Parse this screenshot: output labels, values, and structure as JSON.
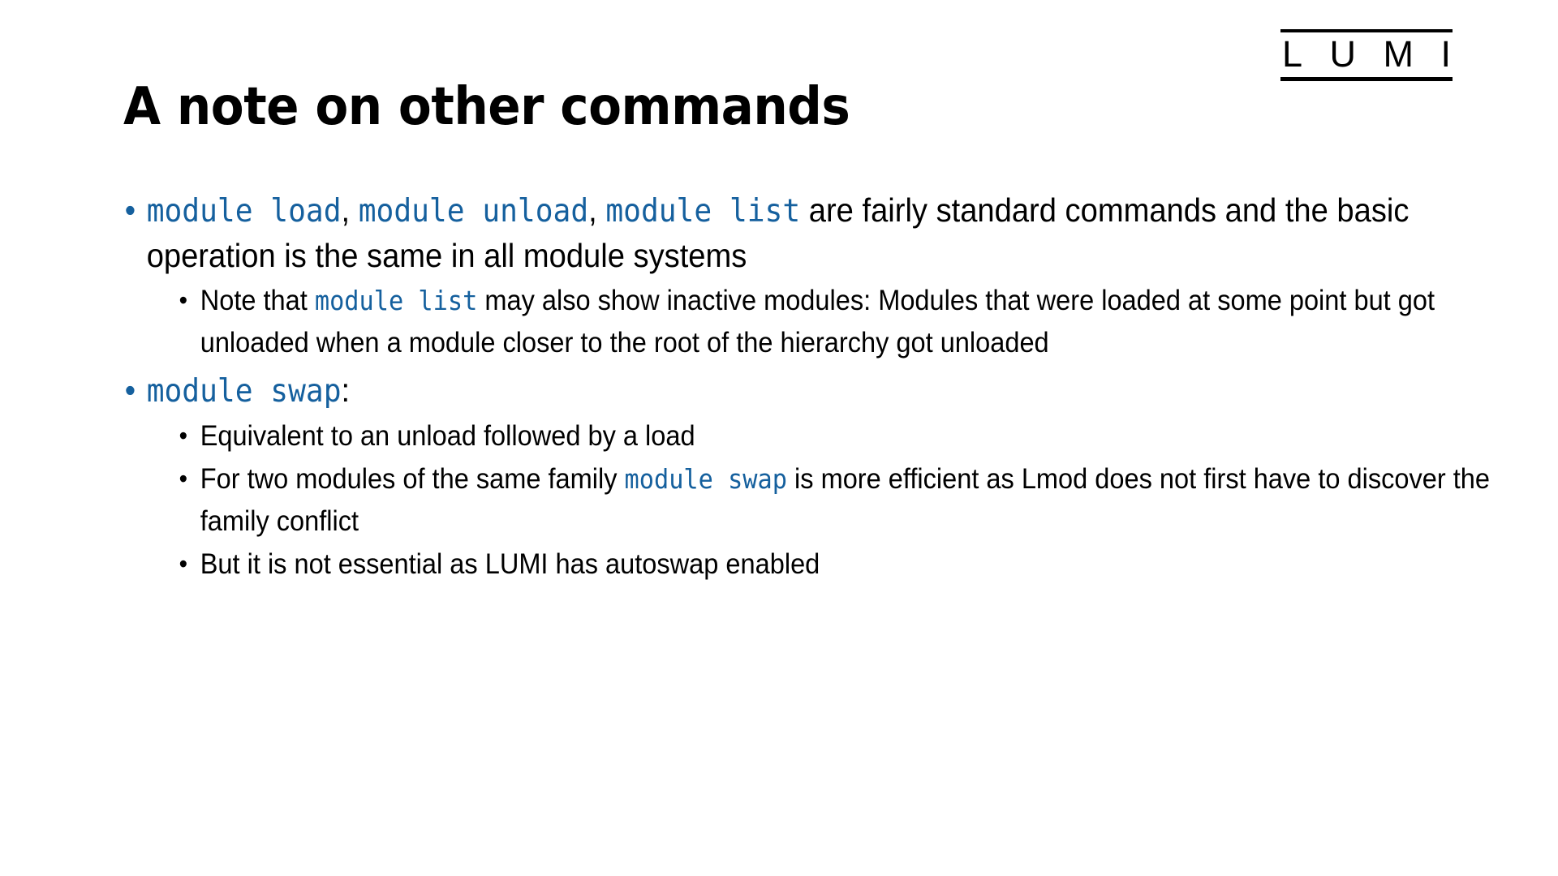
{
  "slide": {
    "title": "A note on other commands",
    "background_color": "#FFFFFF",
    "accent_color": "#15609E",
    "text_color": "#000000"
  },
  "logo": {
    "name": "LUMI",
    "letters": [
      "L",
      "U",
      "M",
      "I"
    ],
    "rule_color": "#000000"
  },
  "bullets": {
    "b1": {
      "marker": "•",
      "code1": "module load",
      "sep1": ", ",
      "code2": "module unload",
      "sep2": ", ",
      "code3": "module list",
      "tail": " are fairly standard commands and the basic operation is the same in all module systems"
    },
    "b1_sub1": {
      "marker": "•",
      "lead": "Note that ",
      "code": "module list",
      "tail": " may also show inactive modules: Modules that were loaded at some point but got unloaded when a module closer to the root of the hierarchy got unloaded"
    },
    "b2": {
      "marker": "•",
      "code": "module swap",
      "tail": ":"
    },
    "b2_sub1": {
      "marker": "•",
      "text": "Equivalent to an unload followed by a load"
    },
    "b2_sub2": {
      "marker": "•",
      "lead": "For two modules of the same family ",
      "code": "module swap",
      "tail": " is more efficient as Lmod does not first have to discover the family conflict"
    },
    "b2_sub3": {
      "marker": "•",
      "text": "But it is not essential as LUMI has autoswap enabled"
    }
  }
}
